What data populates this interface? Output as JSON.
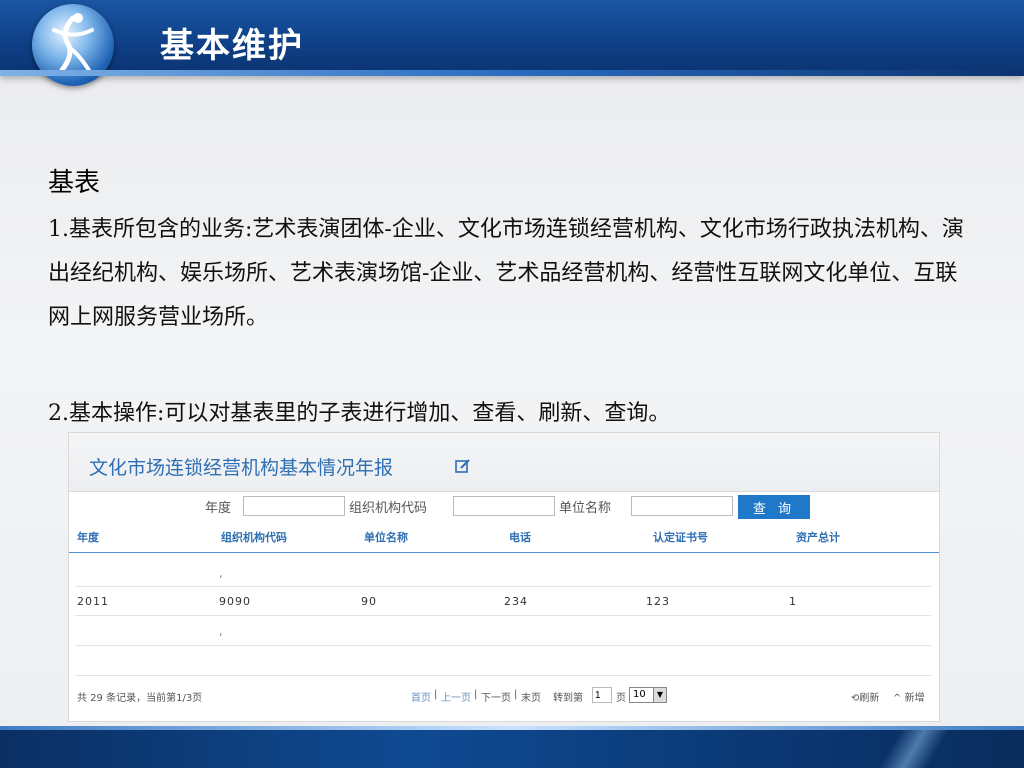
{
  "slide": {
    "title": "基本维护",
    "section": "基表",
    "para1": "1.基表所包含的业务:艺术表演团体-企业、文化市场连锁经营机构、文化市场行政执法机构、演出经纪机构、娱乐场所、艺术表演场馆-企业、艺术品经营机构、经营性互联网文化单位、互联网上网服务营业场所。",
    "para2": "2.基本操作:可以对基表里的子表进行增加、查看、刷新、查询。"
  },
  "panel": {
    "title": "文化市场连锁经营机构基本情况年报",
    "filters": {
      "year_label": "年度",
      "org_code_label": "组织机构代码",
      "unit_name_label": "单位名称",
      "query_button": "查 询"
    },
    "columns": [
      "年度",
      "组织机构代码",
      "单位名称",
      "电话",
      "认定证书号",
      "资产总计"
    ],
    "rows": [
      [
        "",
        ",",
        "",
        "",
        "",
        ""
      ],
      [
        "2011",
        "9090",
        "90",
        "234",
        "123",
        "1"
      ],
      [
        "",
        ",",
        "",
        "",
        "",
        ""
      ]
    ],
    "pager": {
      "summary": "共 29 条记录，当前第1/3页",
      "first": "首页",
      "prev": "上一页",
      "next": "下一页",
      "last": "末页",
      "goto": "转到第",
      "page_value": "1",
      "page_unit": "页",
      "page_size": "10",
      "refresh": "刷新",
      "add": "新增"
    }
  },
  "colors": {
    "header_blue": "#0f3f86",
    "accent_blue": "#2f6fb3",
    "button_blue": "#1f78c8"
  },
  "icons": {
    "logo": "dancer-logo",
    "edit": "edit-icon",
    "refresh": "refresh-icon",
    "add": "caret-up-icon"
  }
}
